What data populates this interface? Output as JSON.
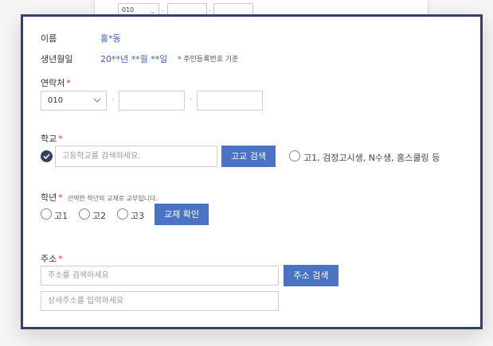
{
  "background_form": {
    "phone_prefix": "010"
  },
  "form": {
    "name": {
      "label": "이름",
      "value": "홍*동"
    },
    "birth": {
      "label": "생년월일",
      "value": "20**년 **월 **일",
      "note": "* 주민등록번호 기준"
    },
    "phone": {
      "label": "연락처",
      "prefix": "010",
      "separator": "-"
    },
    "school": {
      "label": "학교",
      "placeholder": "고등학교를 검색하세요.",
      "search_button": "고교 검색",
      "alt_option": "고1, 검정고시생, N수생, 홈스쿨링 등"
    },
    "grade": {
      "label": "학년",
      "sublabel": "선택한 학년의 교재로 교부됩니다.",
      "options": [
        "고1",
        "고2",
        "고3"
      ],
      "confirm_button": "교재 확인"
    },
    "address": {
      "label": "주소",
      "placeholder": "주소를 검색하세요",
      "search_button": "주소 검색",
      "detail_placeholder": "상세주소를 입력하세요"
    },
    "required_mark": "*"
  },
  "colors": {
    "modal_border": "#34406a",
    "accent_button": "#4a73c4",
    "value_text": "#3f63b0",
    "required": "#d9334a"
  }
}
